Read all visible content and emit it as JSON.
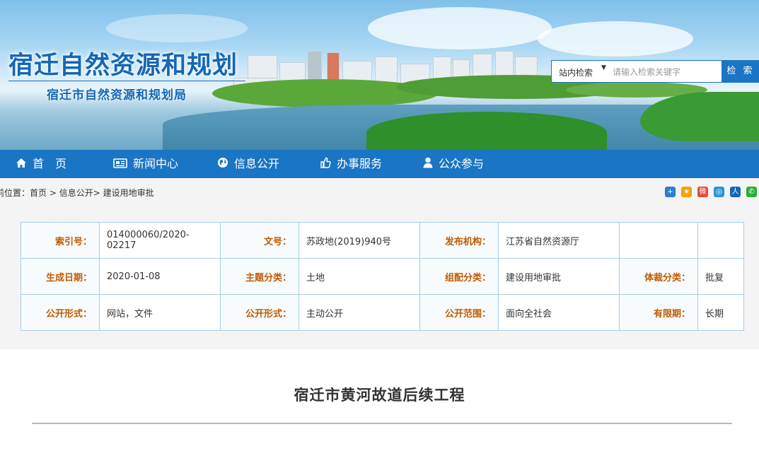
{
  "header": {
    "title": "宿迁自然资源和规划",
    "subtitle": "宿迁市自然资源和规划局"
  },
  "search": {
    "scope": "站内检索",
    "placeholder": "请输入检索关键字",
    "button": "检 索"
  },
  "nav": {
    "items": [
      {
        "label": "首　页",
        "icon": "home-icon"
      },
      {
        "label": "新闻中心",
        "icon": "newspaper-icon"
      },
      {
        "label": "信息公开",
        "icon": "globe-icon"
      },
      {
        "label": "办事服务",
        "icon": "thumbs-up-icon"
      },
      {
        "label": "公众参与",
        "icon": "user-icon"
      }
    ]
  },
  "breadcrumb": {
    "prefix": "前位置：",
    "home": "首页",
    "sep1": " > ",
    "section": "信息公开",
    "sep2": "> ",
    "current": "建设用地审批"
  },
  "share_icons": [
    {
      "name": "add-share-icon",
      "glyph": "+",
      "color": "#2b7fd0"
    },
    {
      "name": "qzone-share-icon",
      "glyph": "★",
      "color": "#f1a400"
    },
    {
      "name": "weibo-share-icon",
      "glyph": "微",
      "color": "#e34a3c"
    },
    {
      "name": "tencent-weibo-share-icon",
      "glyph": "◎",
      "color": "#2a95d7"
    },
    {
      "name": "renren-share-icon",
      "glyph": "人",
      "color": "#1566b7"
    },
    {
      "name": "wechat-share-icon",
      "glyph": "✆",
      "color": "#2aae3a"
    }
  ],
  "info": {
    "index_label": "索引号：",
    "index_value": "014000060/2020-02217",
    "doc_no_label": "文号：",
    "doc_no_value": "苏政地(2019)940号",
    "publisher_label": "发布机构：",
    "publisher_value": "江苏省自然资源厅",
    "date_label": "生成日期：",
    "date_value": "2020-01-08",
    "topic_label": "主题分类：",
    "topic_value": "土地",
    "group_label": "组配分类：",
    "group_value": "建设用地审批",
    "genre_label": "体裁分类：",
    "genre_value": "批复",
    "form_label": "公开形式：",
    "form_value": "网站，文件",
    "mode_label": "公开形式：",
    "mode_value": "主动公开",
    "scope_label": "公开范围：",
    "scope_value": "面向全社会",
    "validity_label": "有限期：",
    "validity_value": "长期"
  },
  "article": {
    "title": "宿迁市黄河故道后续工程"
  }
}
